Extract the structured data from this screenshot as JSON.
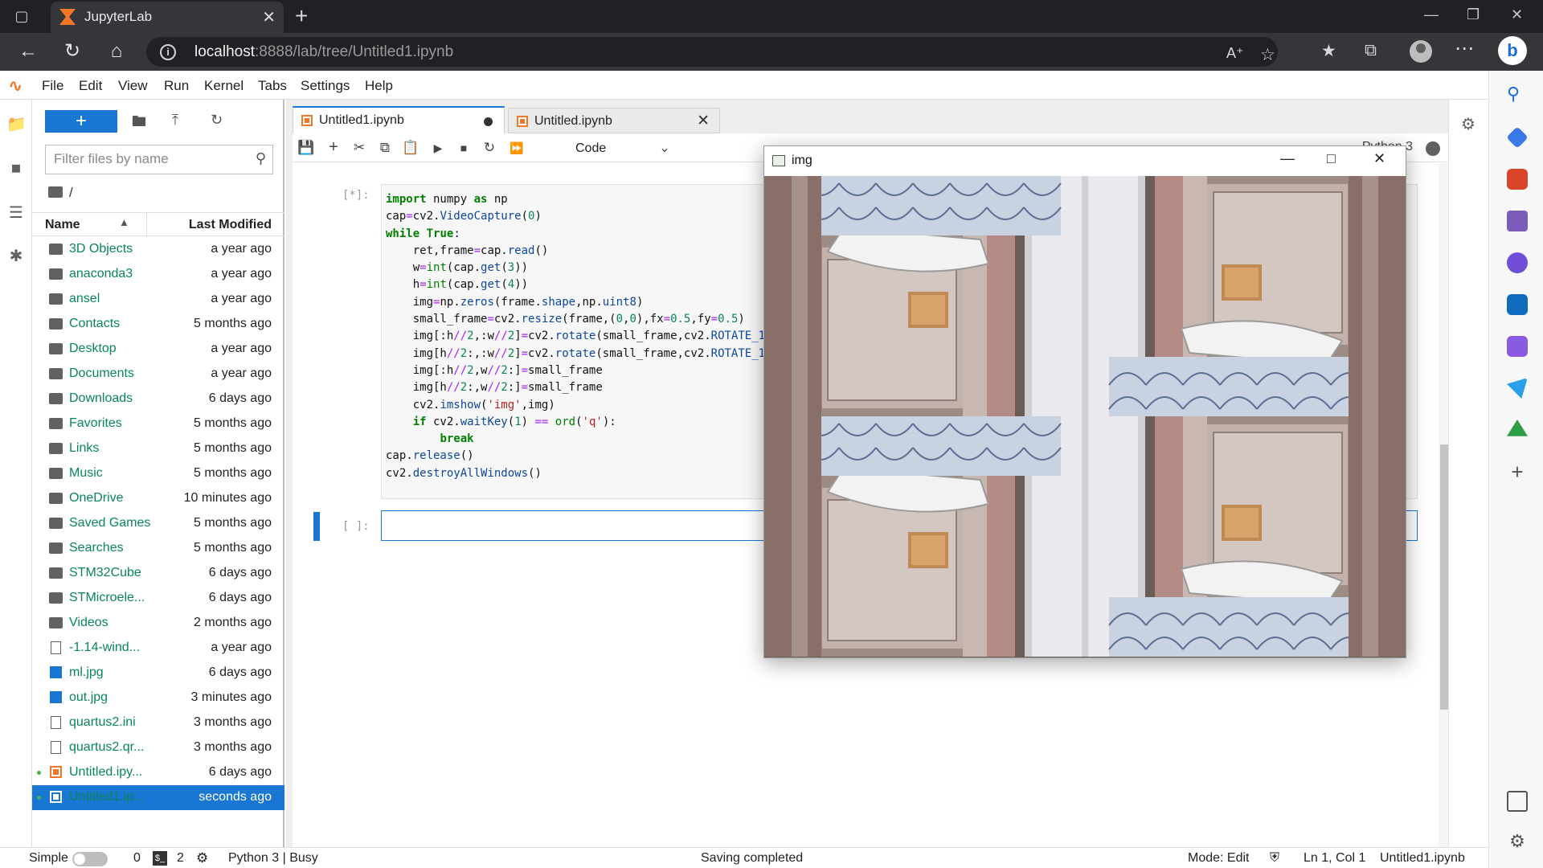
{
  "browser": {
    "tab_title": "JupyterLab",
    "url_host": "localhost",
    "url_path": ":8888/lab/tree/Untitled1.ipynb"
  },
  "menu": [
    "File",
    "Edit",
    "View",
    "Run",
    "Kernel",
    "Tabs",
    "Settings",
    "Help"
  ],
  "filebrowser": {
    "new_label": "+",
    "filter_placeholder": "Filter files by name",
    "breadcrumb": "/",
    "col_name": "Name",
    "col_modified": "Last Modified",
    "files": [
      {
        "name": "3D Objects",
        "modified": "a year ago",
        "type": "folder"
      },
      {
        "name": "anaconda3",
        "modified": "a year ago",
        "type": "folder"
      },
      {
        "name": "ansel",
        "modified": "a year ago",
        "type": "folder"
      },
      {
        "name": "Contacts",
        "modified": "5 months ago",
        "type": "folder"
      },
      {
        "name": "Desktop",
        "modified": "a year ago",
        "type": "folder"
      },
      {
        "name": "Documents",
        "modified": "a year ago",
        "type": "folder"
      },
      {
        "name": "Downloads",
        "modified": "6 days ago",
        "type": "folder"
      },
      {
        "name": "Favorites",
        "modified": "5 months ago",
        "type": "folder"
      },
      {
        "name": "Links",
        "modified": "5 months ago",
        "type": "folder"
      },
      {
        "name": "Music",
        "modified": "5 months ago",
        "type": "folder"
      },
      {
        "name": "OneDrive",
        "modified": "10 minutes ago",
        "type": "folder"
      },
      {
        "name": "Saved Games",
        "modified": "5 months ago",
        "type": "folder"
      },
      {
        "name": "Searches",
        "modified": "5 months ago",
        "type": "folder"
      },
      {
        "name": "STM32Cube",
        "modified": "6 days ago",
        "type": "folder"
      },
      {
        "name": "STMicroele...",
        "modified": "6 days ago",
        "type": "folder"
      },
      {
        "name": "Videos",
        "modified": "2 months ago",
        "type": "folder"
      },
      {
        "name": "-1.14-wind...",
        "modified": "a year ago",
        "type": "file"
      },
      {
        "name": "ml.jpg",
        "modified": "6 days ago",
        "type": "image"
      },
      {
        "name": "out.jpg",
        "modified": "3 minutes ago",
        "type": "image"
      },
      {
        "name": "quartus2.ini",
        "modified": "3 months ago",
        "type": "file"
      },
      {
        "name": "quartus2.qr...",
        "modified": "3 months ago",
        "type": "file"
      },
      {
        "name": "Untitled.ipy...",
        "modified": "6 days ago",
        "type": "notebook",
        "running": true
      },
      {
        "name": "Untitled1.ip...",
        "modified": "seconds ago",
        "type": "notebook",
        "running": true,
        "selected": true
      }
    ]
  },
  "notebook": {
    "tabs": [
      {
        "label": "Untitled1.ipynb",
        "active": true,
        "dirty": true
      },
      {
        "label": "Untitled.ipynb",
        "active": false
      }
    ],
    "cell_type": "Code",
    "kernel_name": "Python 3",
    "cells": [
      {
        "prompt": "[*]:"
      },
      {
        "prompt": "[ ]:"
      }
    ]
  },
  "statusbar": {
    "simple_label": "Simple",
    "terminals_count": "0",
    "kernels_count": "2",
    "kernel_status": "Python 3 | Busy",
    "save_status": "Saving completed",
    "mode": "Mode: Edit",
    "cursor": "Ln 1, Col 1",
    "file_name": "Untitled1.ipynb"
  },
  "cv_window": {
    "title": "img"
  },
  "colors": {
    "jupyter_orange": "#f37726",
    "jupyter_blue": "#1976d2",
    "browser_dark": "#202124"
  }
}
